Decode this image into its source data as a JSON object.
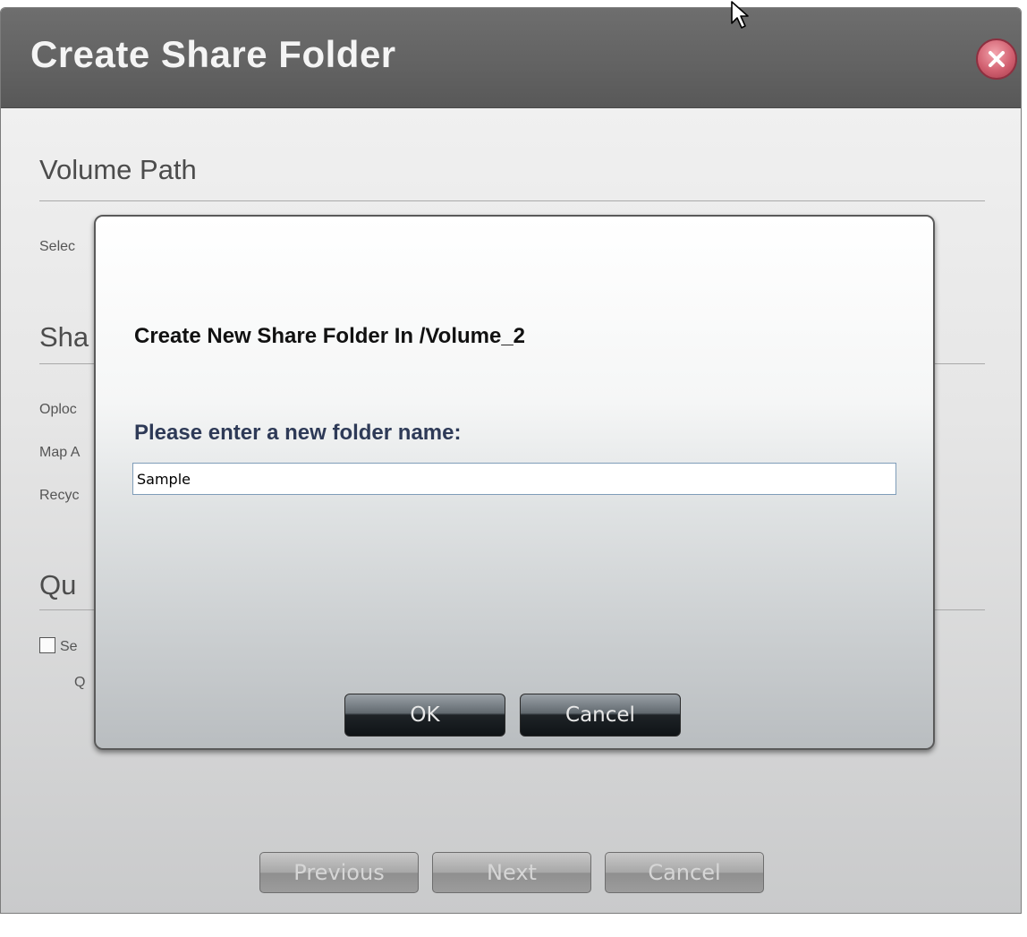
{
  "window": {
    "title": "Create Share Folder",
    "close_icon": "close-icon"
  },
  "background": {
    "volume_path_heading": "Volume Path",
    "select_text": "Selec",
    "share_heading": "Sha",
    "oplock_text": "Oploc",
    "map_text": "Map A",
    "recycle_text": "Recyc",
    "quota_heading": "Qu",
    "quota_checkbox_text": "Se",
    "quota_sub_text": "Q"
  },
  "wizard_buttons": {
    "previous": "Previous",
    "next": "Next",
    "cancel": "Cancel"
  },
  "dialog": {
    "title": "Create New Share Folder In /Volume_2",
    "prompt": "Please enter a new folder name:",
    "folder_name_value": "Sample",
    "ok": "OK",
    "cancel": "Cancel"
  }
}
